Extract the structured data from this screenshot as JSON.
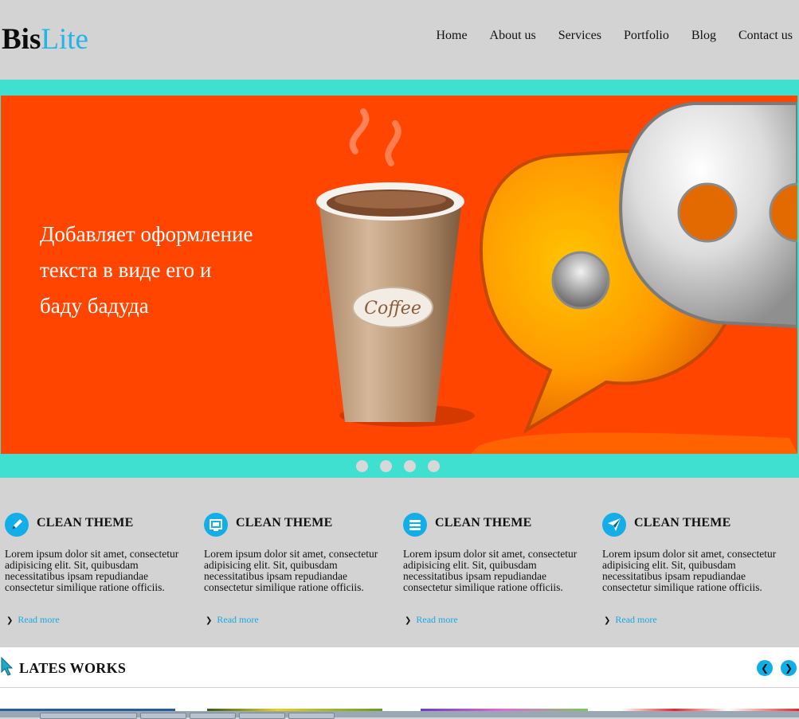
{
  "header": {
    "logo_bold": "Bis",
    "logo_light": "Lite",
    "nav": [
      "Home",
      "About us",
      "Services",
      "Portfolio",
      "Blog",
      "Contact us"
    ]
  },
  "slider": {
    "headline_lines": [
      "Добавляет оформление",
      "текста в виде его и",
      "баду бадуда"
    ],
    "cup_label": "Coffee",
    "slide_count": 4,
    "colors": {
      "band": "#40e0d0",
      "slide_bg": "#ff4500"
    }
  },
  "features": [
    {
      "icon": "pencil-icon",
      "title": "CLEAN THEME",
      "text": "Lorem ipsum dolor sit amet, consectetur adipisicing elit. Sit, quibusdam necessitatibus ipsam repudiandae consectetur similique ratione officiis.",
      "more": "Read more"
    },
    {
      "icon": "screen-icon",
      "title": "CLEAN THEME",
      "text": "Lorem ipsum dolor sit amet, consectetur adipisicing elit. Sit, quibusdam necessitatibus ipsam repudiandae consectetur similique ratione officiis.",
      "more": "Read more"
    },
    {
      "icon": "list-icon",
      "title": "CLEAN THEME",
      "text": "Lorem ipsum dolor sit amet, consectetur adipisicing elit. Sit, quibusdam necessitatibus ipsam repudiandae consectetur similique ratione officiis.",
      "more": "Read more"
    },
    {
      "icon": "paper-plane-icon",
      "title": "CLEAN THEME",
      "text": "Lorem ipsum dolor sit amet, consectetur adipisicing elit. Sit, quibusdam necessitatibus ipsam repudiandae consectetur similique ratione officiis.",
      "more": "Read more"
    }
  ],
  "works": {
    "title": "LATES WORKS",
    "prev_icon": "chevron-left-icon",
    "next_icon": "chevron-right-icon"
  }
}
